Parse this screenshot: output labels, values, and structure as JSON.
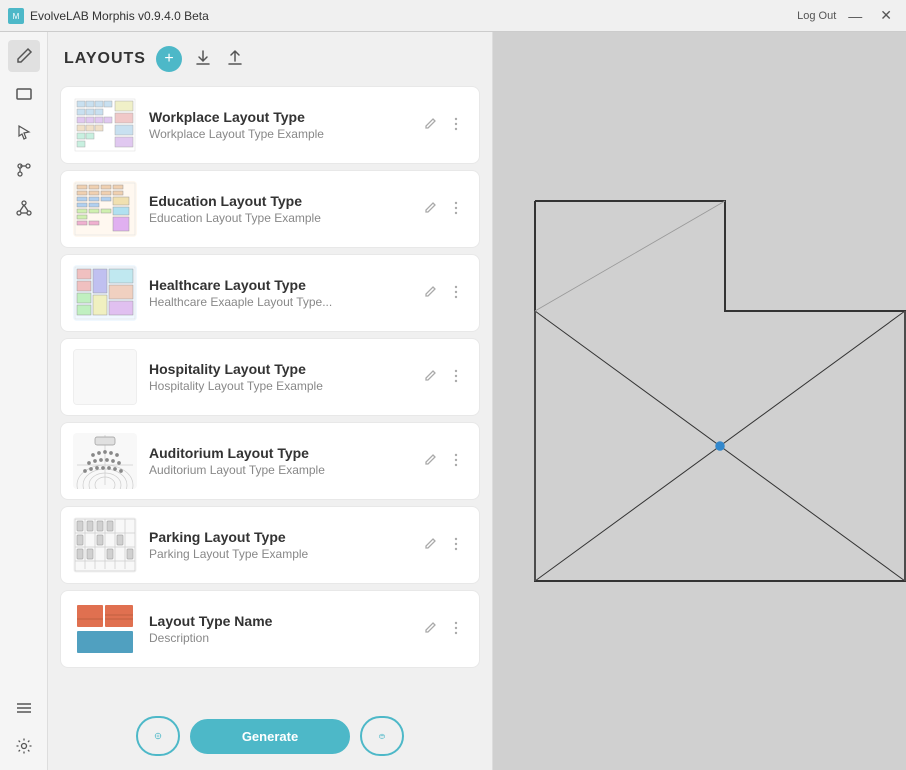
{
  "titlebar": {
    "logo_text": "EvolveLAB Morphis v0.9.4.0 Beta",
    "logout_label": "Log Out",
    "minimize_label": "—",
    "close_label": "✕"
  },
  "toolbar": {
    "tools": [
      {
        "name": "pencil",
        "icon": "✏",
        "active": true
      },
      {
        "name": "shape",
        "icon": "⬜",
        "active": false
      },
      {
        "name": "cursor",
        "icon": "↗",
        "active": false
      },
      {
        "name": "branch",
        "icon": "⎇",
        "active": false
      },
      {
        "name": "node",
        "icon": "⊕",
        "active": false
      },
      {
        "name": "list",
        "icon": "☰",
        "active": false
      },
      {
        "name": "settings",
        "icon": "⚙",
        "active": false
      }
    ]
  },
  "panel": {
    "title": "LAYOUTS",
    "add_btn": "+",
    "import_btn": "↓",
    "export_btn": "↑"
  },
  "layouts": [
    {
      "id": "workplace",
      "name": "Workplace Layout Type",
      "description": "Workplace Layout Type Example",
      "has_thumb": true
    },
    {
      "id": "education",
      "name": "Education Layout Type",
      "description": "Education Layout Type Example",
      "has_thumb": true
    },
    {
      "id": "healthcare",
      "name": "Healthcare Layout Type",
      "description": "Healthcare Exaaple Layout Type...",
      "has_thumb": true
    },
    {
      "id": "hospitality",
      "name": "Hospitality Layout Type",
      "description": "Hospitality Layout Type Example",
      "has_thumb": false
    },
    {
      "id": "auditorium",
      "name": "Auditorium Layout Type",
      "description": "Auditorium Layout Type Example",
      "has_thumb": true
    },
    {
      "id": "parking",
      "name": "Parking Layout Type",
      "description": "Parking Layout Type Example",
      "has_thumb": true
    },
    {
      "id": "layout-name",
      "name": "Layout Type Name",
      "description": "Description",
      "has_thumb": true
    }
  ],
  "footer": {
    "generate_label": "Generate",
    "cursor_icon": "⌖",
    "cube_icon": "◈"
  }
}
